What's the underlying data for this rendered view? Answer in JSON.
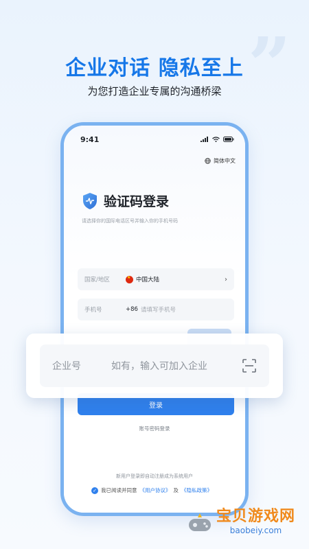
{
  "hero": {
    "title": "企业对话  隐私至上",
    "subtitle": "为您打造企业专属的沟通桥梁"
  },
  "status_bar": {
    "time": "9:41"
  },
  "language": {
    "label": "简体中文"
  },
  "login": {
    "title": "验证码登录",
    "hint": "请选择你的国际电话区号并输入你的手机号码",
    "region_label": "国家/地区",
    "region_value": "中国大陆",
    "phone_label": "手机号",
    "dial_code": "+86",
    "phone_placeholder": "请填写手机号",
    "submit_label": "登录",
    "alt_login_label": "账号密码登录",
    "auto_register_note": "新用户登录即自动注册成为系统用户",
    "agreement_prefix": "我已阅读并同意",
    "user_agreement": "《用户协议》",
    "agreement_and": "及",
    "privacy_policy": "《隐私政策》"
  },
  "enterprise_card": {
    "label": "企业号",
    "placeholder": "如有，输入可加入企业"
  },
  "watermark": {
    "title": "宝贝游戏网",
    "url": "baobeiy.com"
  },
  "colors": {
    "accent": "#2f80ed",
    "headline": "#1677e8",
    "phone_border": "#7ab2f0"
  }
}
